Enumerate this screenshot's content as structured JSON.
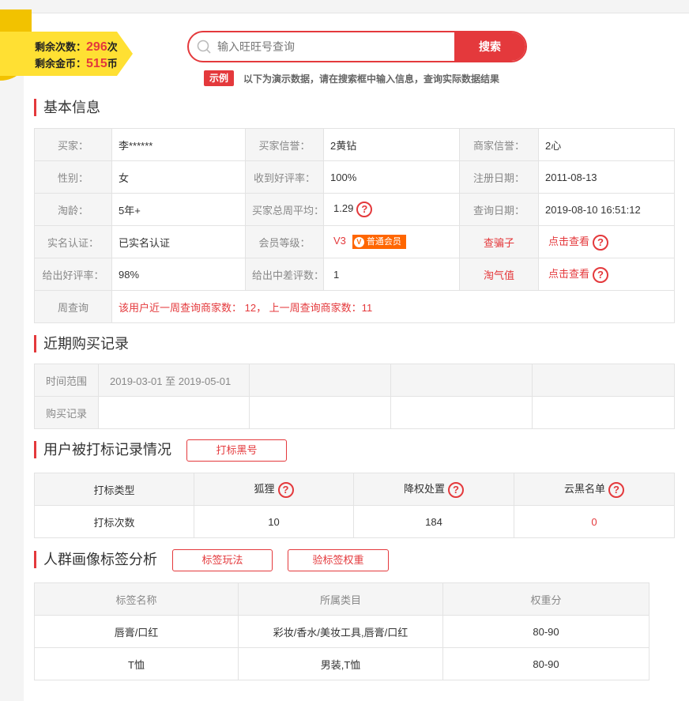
{
  "balance": {
    "times_label": "剩余次数：",
    "times_value": "296",
    "times_unit": "次",
    "coins_label": "剩余金币：",
    "coins_value": "515",
    "coins_unit": "币"
  },
  "search": {
    "placeholder": "输入旺旺号查询",
    "button": "搜索"
  },
  "demo": {
    "tag": "示例",
    "text": "以下为演示数据，请在搜索框中输入信息，查询实际数据结果"
  },
  "basic": {
    "title": "基本信息",
    "buyer_label": "买家：",
    "buyer_value": "李******",
    "buyer_credit_label": "买家信誉：",
    "buyer_credit_value": "2黄钻",
    "seller_credit_label": "商家信誉：",
    "seller_credit_value": "2心",
    "gender_label": "性别：",
    "gender_value": "女",
    "good_rate_recv_label": "收到好评率：",
    "good_rate_recv_value": "100%",
    "reg_date_label": "注册日期：",
    "reg_date_value": "2011-08-13",
    "age_label": "淘龄：",
    "age_value": "5年+",
    "weekly_avg_label": "买家总周平均：",
    "weekly_avg_value": "1.29",
    "query_date_label": "查询日期：",
    "query_date_value": "2019-08-10 16:51:12",
    "realname_label": "实名认证：",
    "realname_value": "已实名认证",
    "member_label": "会员等级：",
    "member_level": "V3",
    "member_badge_v": "V",
    "member_badge": "普通会员",
    "scam_label": "查骗子",
    "scam_link": "点击查看",
    "good_rate_given_label": "给出好评率：",
    "good_rate_given_value": "98%",
    "bad_given_label": "给出中差评数：",
    "bad_given_value": "1",
    "taoqi_label": "淘气值",
    "taoqi_link": "点击查看",
    "weekly_query_label": "周查询",
    "weekly_query_value": "该用户近一周查询商家数： 12， 上一周查询商家数：11"
  },
  "purchases": {
    "title": "近期购买记录",
    "range_label": "时间范围",
    "range_value": "2019-03-01 至 2019-05-01",
    "records_label": "购买记录"
  },
  "marks": {
    "title": "用户被打标记录情况",
    "button": "打标黑号",
    "col_type": "打标类型",
    "col_fox": "狐狸",
    "col_demote": "降权处置",
    "col_cloud": "云黑名单",
    "row_label": "打标次数",
    "fox_count": "10",
    "demote_count": "184",
    "cloud_count": "0"
  },
  "tags": {
    "title": "人群画像标签分析",
    "button1": "标签玩法",
    "button2": "验标签权重",
    "col_name": "标签名称",
    "col_category": "所属类目",
    "col_weight": "权重分",
    "rows": [
      {
        "name": "唇膏/口红",
        "category": "彩妆/香水/美妆工具,唇膏/口红",
        "weight": "80-90"
      },
      {
        "name": "T恤",
        "category": "男装,T恤",
        "weight": "80-90"
      }
    ]
  },
  "help_glyph": "?"
}
